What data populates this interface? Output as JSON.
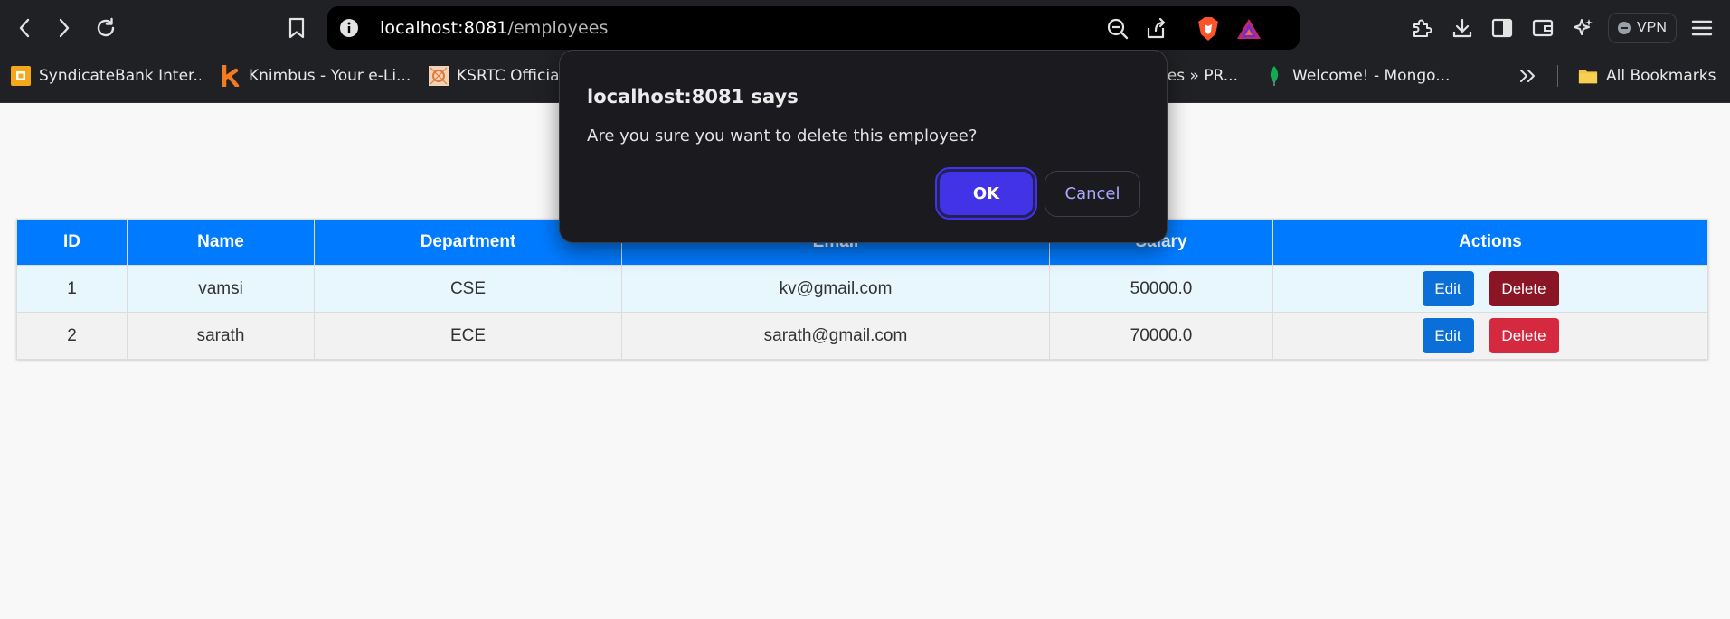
{
  "browser": {
    "url_host": "localhost:8081",
    "url_path": "/employees",
    "vpn_label": "VPN",
    "bookmarks": [
      {
        "label": "SyndicateBank Inter...",
        "icon": "syndicatebank-icon"
      },
      {
        "label": "Knimbus - Your e-Li...",
        "icon": "knimbus-icon"
      },
      {
        "label": "KSRTC Official",
        "icon": "ksrtc-icon"
      },
      {
        "label": "des » PR...",
        "icon": "bookmark-icon"
      },
      {
        "label": "Welcome! - Mongo...",
        "icon": "mongodb-leaf-icon"
      }
    ],
    "all_bookmarks_label": "All Bookmarks"
  },
  "dialog": {
    "title": "localhost:8081 says",
    "message": "Are you sure you want to delete this employee?",
    "ok_label": "OK",
    "cancel_label": "Cancel"
  },
  "table": {
    "headers": [
      "ID",
      "Name",
      "Department",
      "Email",
      "Salary",
      "Actions"
    ],
    "rows": [
      {
        "id": "1",
        "name": "vamsi",
        "department": "CSE",
        "email": "kv@gmail.com",
        "salary": "50000.0",
        "edit_label": "Edit",
        "delete_label": "Delete"
      },
      {
        "id": "2",
        "name": "sarath",
        "department": "ECE",
        "email": "sarath@gmail.com",
        "salary": "70000.0",
        "edit_label": "Edit",
        "delete_label": "Delete"
      }
    ]
  },
  "colors": {
    "header_bg": "#007bff",
    "edit_button": "#0b6fd9",
    "delete_button": "#d5293f",
    "dialog_ok": "#4234e6"
  }
}
